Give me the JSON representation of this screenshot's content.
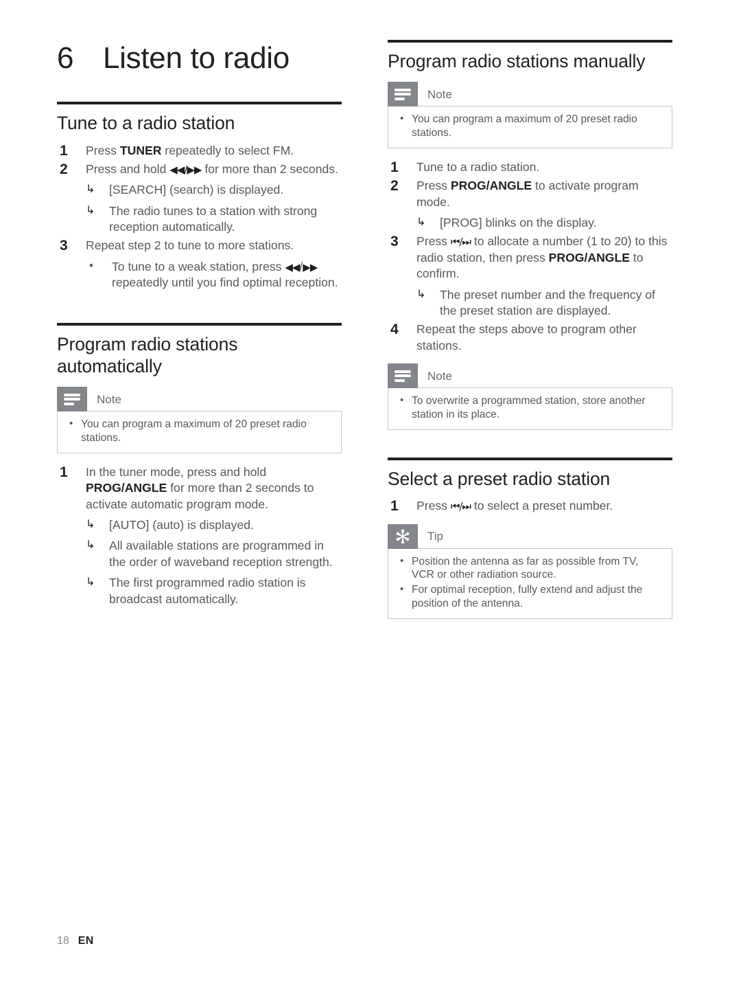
{
  "colors": {
    "heading": "#231f20",
    "body_text": "#5b565b",
    "callout_badge": "#83868b",
    "callout_border": "#c8c6c9",
    "rule": "#231f20"
  },
  "chapter": {
    "number": "6",
    "title": "Listen to radio"
  },
  "sections": {
    "tune": {
      "heading": "Tune to a radio station",
      "steps": [
        {
          "num": "1",
          "parts": [
            {
              "t": "Press "
            },
            {
              "t": "TUNER",
              "bold": true
            },
            {
              "t": " repeatedly to select FM."
            }
          ],
          "results": [],
          "bullets": []
        },
        {
          "num": "2",
          "parts": [
            {
              "t": "Press and hold "
            },
            {
              "t": "◀◀/▶▶",
              "glyph": true
            },
            {
              "t": " for more than 2 seconds."
            }
          ],
          "results": [
            "[SEARCH] (search) is displayed.",
            "The radio tunes to a station with strong reception automatically."
          ],
          "bullets": []
        },
        {
          "num": "3",
          "parts": [
            {
              "t": "Repeat step 2 to tune to more stations."
            }
          ],
          "results": [],
          "bullets": [
            {
              "parts": [
                {
                  "t": "To tune to a weak station, press "
                },
                {
                  "t": "◀◀",
                  "glyph": true
                },
                {
                  "t": "/"
                },
                {
                  "t": "▶▶",
                  "glyph": true
                },
                {
                  "t": " repeatedly until you find optimal reception."
                }
              ]
            }
          ]
        }
      ]
    },
    "program_auto": {
      "heading": "Program radio stations automatically",
      "note": {
        "label": "Note",
        "icon": "note-lines-icon",
        "items": [
          "You can program a maximum of 20 preset radio stations."
        ]
      },
      "steps": [
        {
          "num": "1",
          "parts": [
            {
              "t": "In the tuner mode, press and hold "
            },
            {
              "t": "PROG/ANGLE",
              "bold": true
            },
            {
              "t": " for more than 2 seconds to activate automatic program mode."
            }
          ],
          "results": [
            "[AUTO] (auto) is displayed.",
            "All available stations are programmed in the order of waveband reception strength.",
            "The first programmed radio station is broadcast automatically."
          ],
          "bullets": []
        }
      ]
    },
    "program_manual": {
      "heading": "Program radio stations manually",
      "note": {
        "label": "Note",
        "icon": "note-lines-icon",
        "items": [
          "You can program a maximum of 20 preset radio stations."
        ]
      },
      "steps": [
        {
          "num": "1",
          "parts": [
            {
              "t": "Tune to a radio station."
            }
          ],
          "results": [],
          "bullets": []
        },
        {
          "num": "2",
          "parts": [
            {
              "t": "Press "
            },
            {
              "t": "PROG/ANGLE",
              "bold": true
            },
            {
              "t": " to activate program mode."
            }
          ],
          "results": [
            "[PROG] blinks on the display."
          ],
          "bullets": []
        },
        {
          "num": "3",
          "parts": [
            {
              "t": "Press "
            },
            {
              "t": "⏮/⏭",
              "glyph": true
            },
            {
              "t": " to allocate a number (1 to 20) to this radio station, then press "
            },
            {
              "t": "PROG/ANGLE",
              "bold": true
            },
            {
              "t": " to confirm."
            }
          ],
          "results": [
            "The preset number and the frequency of the preset station are displayed."
          ],
          "bullets": []
        },
        {
          "num": "4",
          "parts": [
            {
              "t": "Repeat the steps above to program other stations."
            }
          ],
          "results": [],
          "bullets": []
        }
      ],
      "note2": {
        "label": "Note",
        "icon": "note-lines-icon",
        "items": [
          "To overwrite a programmed station, store another station in its place."
        ]
      }
    },
    "select_preset": {
      "heading": "Select a preset radio station",
      "steps": [
        {
          "num": "1",
          "parts": [
            {
              "t": "Press "
            },
            {
              "t": "⏮/⏭",
              "glyph": true
            },
            {
              "t": " to select a preset number."
            }
          ],
          "results": [],
          "bullets": []
        }
      ],
      "tip": {
        "label": "Tip",
        "icon": "tip-asterisk-icon",
        "items": [
          "Position the antenna as far as possible from TV, VCR or other radiation source.",
          "For optimal reception, fully extend and adjust the position of the antenna."
        ]
      }
    }
  },
  "footer": {
    "page_number": "18",
    "language": "EN"
  }
}
